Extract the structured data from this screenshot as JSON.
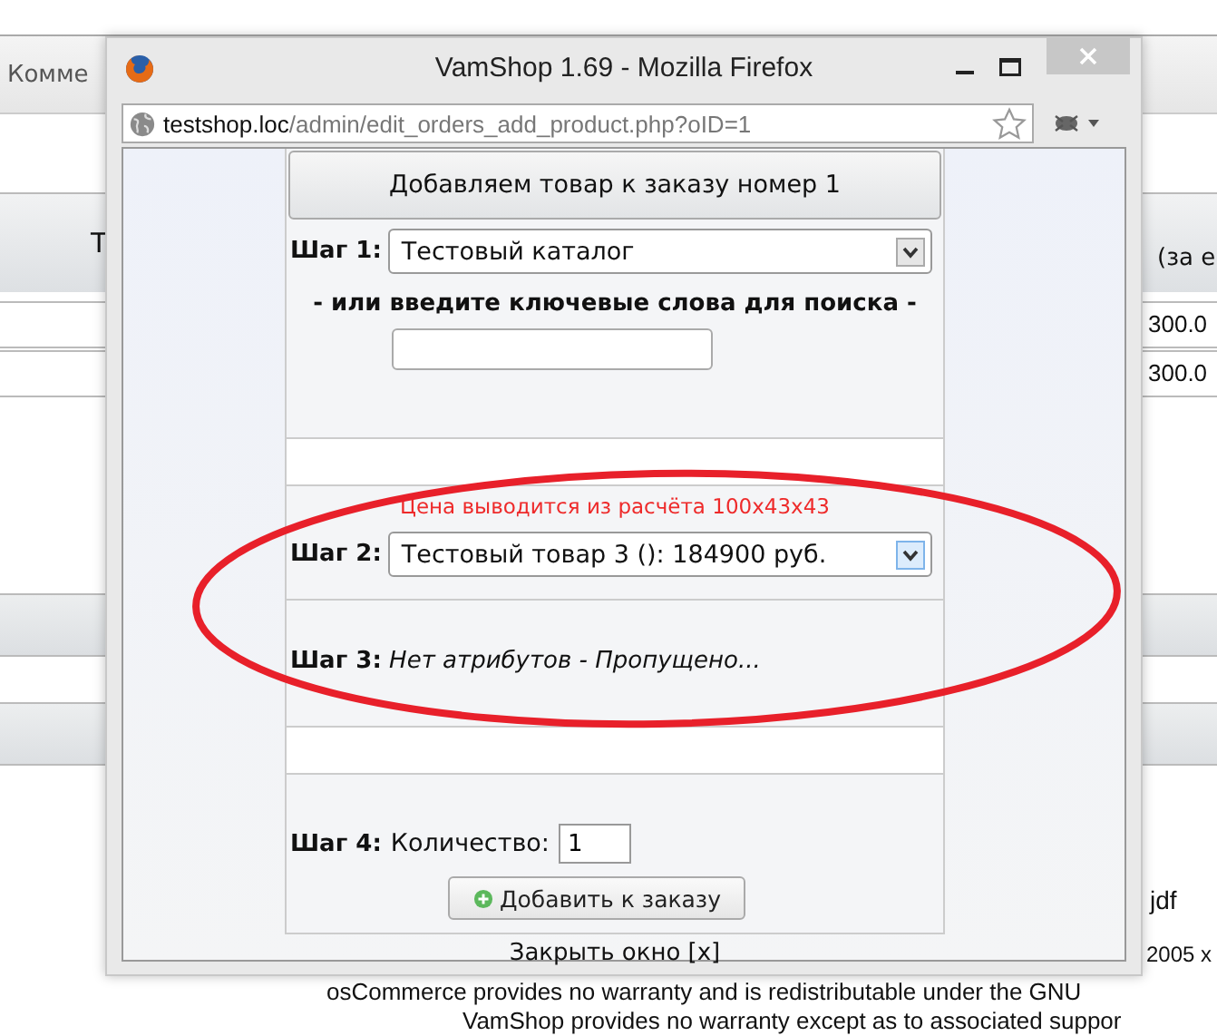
{
  "background_page": {
    "tab": "Комме",
    "header_left": "Т",
    "header_right": "(за е",
    "rows": [
      "300.0",
      "300.0"
    ],
    "note": "jdf",
    "footer": [
      "2005 x",
      "osCommerce provides no warranty and is redistributable under the GNU",
      "VamShop provides no warranty except as to associated suppor"
    ]
  },
  "window": {
    "title": "VamShop 1.69 - Mozilla Firefox",
    "url_host": "testshop.loc",
    "url_path": "/admin/edit_orders_add_product.php?oID=1"
  },
  "form": {
    "heading": "Добавляем товар к заказу номер 1",
    "step1": {
      "label": "Шаг 1:",
      "value": "Тестовый каталог"
    },
    "search_label": "- или введите ключевые слова для поиска -",
    "price_note": "Цена выводится из расчёта 100x43x43",
    "step2": {
      "label": "Шаг 2:",
      "value": "Тестовый товар 3 (): 184900 руб."
    },
    "step3": {
      "label": "Шаг 3:",
      "value": "Нет атрибутов - Пропущено..."
    },
    "step4": {
      "label": "Шаг 4:",
      "text": "Количество:",
      "quantity": "1"
    },
    "add_button": "Добавить к заказу",
    "close_link": "Закрыть окно [x]"
  }
}
